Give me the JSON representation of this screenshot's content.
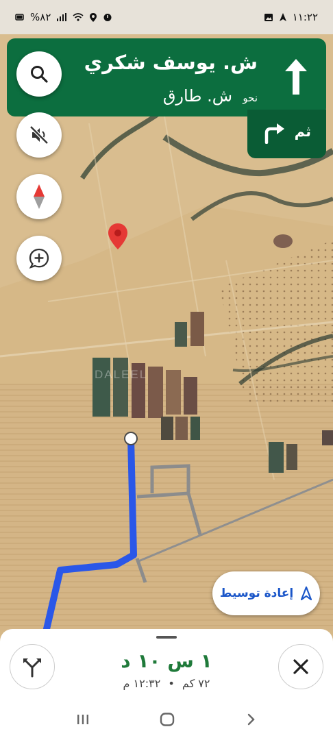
{
  "status_bar": {
    "time": "١١:٢٢",
    "battery": "%٨٢",
    "icons": [
      "photo-icon",
      "navigation-icon",
      "alarm-icon",
      "location-icon",
      "wifi-icon",
      "signal-icon",
      "battery-icon"
    ]
  },
  "navigation": {
    "street": "ش. يوسف شكري",
    "toward_prefix": "نحو",
    "toward_name": "ش. طارق",
    "then_label": "ثم",
    "direction_icon": "arrow-up-icon",
    "then_icon": "turn-right-icon",
    "colors": {
      "banner": "#0c6e3f",
      "then_card": "#0a5c35"
    }
  },
  "map_controls": {
    "search_icon": "search-icon",
    "mute_icon": "sound-off-icon",
    "compass_icon": "compass-icon",
    "report_icon": "add-report-icon"
  },
  "map": {
    "watermark": "DALEEL",
    "route_color": "#2a57e8",
    "destination_color": "#e53935"
  },
  "recenter": {
    "label": "إعادة توسيط",
    "icon": "navigation-arrow-icon"
  },
  "trip": {
    "duration": "١ س ١٠ د",
    "distance": "٧٢ كم",
    "separator": "•",
    "arrival": "١٢:٣٢ م",
    "routes_icon": "alt-routes-icon",
    "close_icon": "close-icon"
  },
  "system_nav": {
    "recent_icon": "recents-icon",
    "home_icon": "home-icon",
    "back_icon": "back-icon"
  }
}
